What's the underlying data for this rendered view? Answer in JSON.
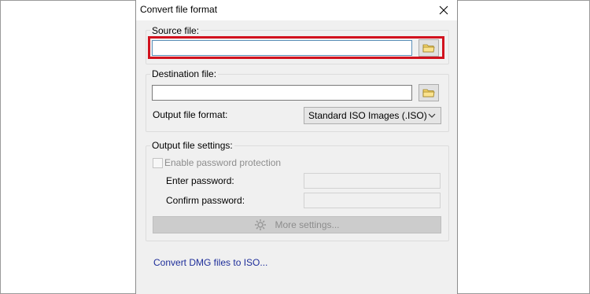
{
  "dialog": {
    "title": "Convert file format",
    "close_icon": "close-icon"
  },
  "source": {
    "group_label": "Source file:",
    "path_value": "",
    "browse_icon": "folder-icon"
  },
  "destination": {
    "group_label": "Destination file:",
    "path_value": "",
    "browse_icon": "folder-icon",
    "format_label": "Output file format:",
    "format_selected": "Standard ISO Images (.ISO)"
  },
  "settings": {
    "group_label": "Output file settings:",
    "password_checkbox_label": "Enable password protection",
    "password_checked": false,
    "enter_password_label": "Enter password:",
    "confirm_password_label": "Confirm password:",
    "more_settings_label": "More settings...",
    "more_settings_icon": "gear-icon"
  },
  "footer": {
    "link_text": "Convert DMG files to ISO..."
  },
  "colors": {
    "highlight": "#d1121e",
    "link": "#1e2e9a",
    "dialog_bg": "#f0f0f0"
  }
}
